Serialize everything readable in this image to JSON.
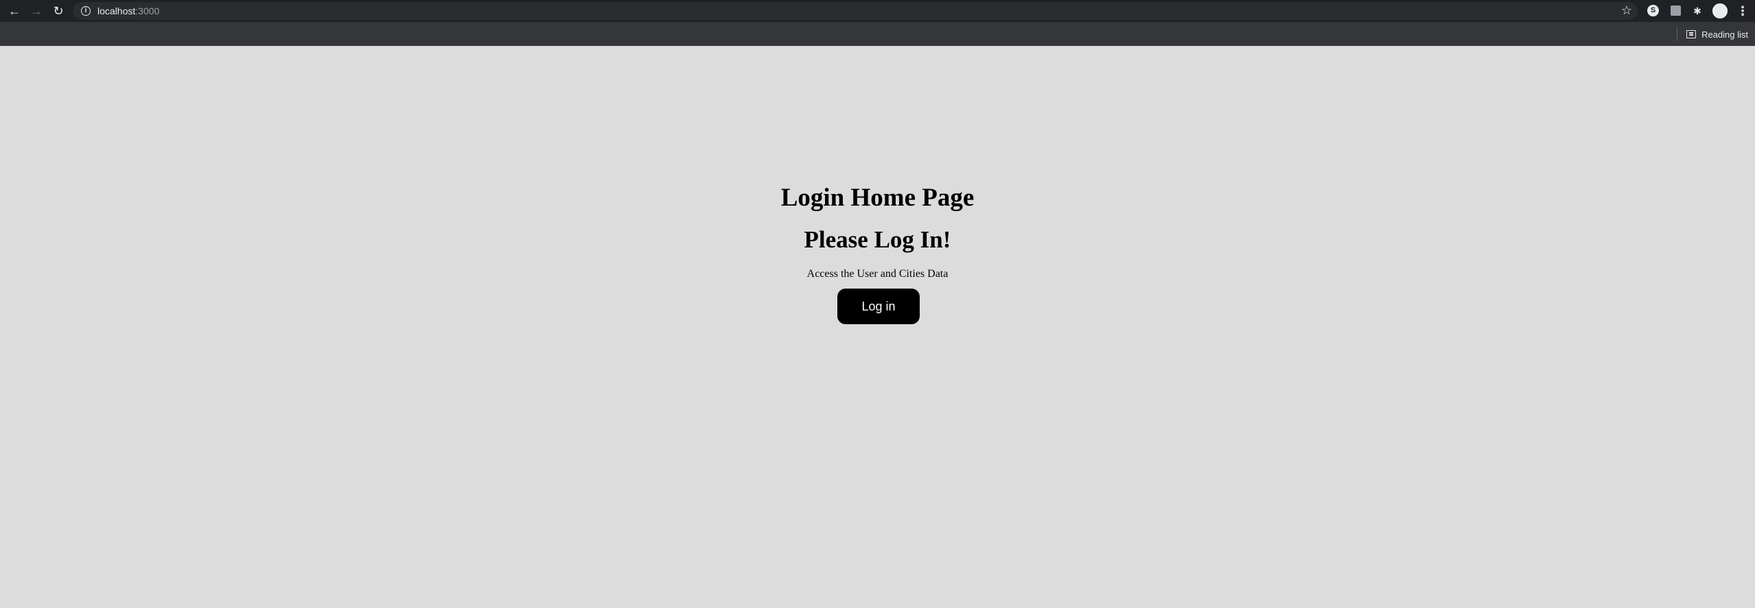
{
  "browser": {
    "url_host": "localhost",
    "url_port": ":3000",
    "reading_list_label": "Reading list",
    "extension_s_label": "S"
  },
  "page": {
    "title": "Login Home Page",
    "heading": "Please Log In!",
    "subtitle": "Access the User and Cities Data",
    "login_button_label": "Log in"
  }
}
